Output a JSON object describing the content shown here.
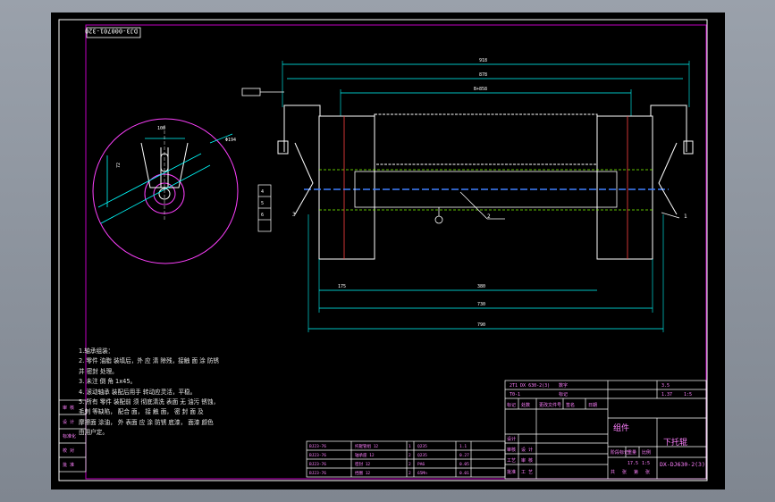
{
  "drawing": {
    "code_tag": "DJ3-000701-320",
    "title_component": "组件",
    "title_name": "下托辊",
    "title_code": "DX-DJ630-2(3)"
  },
  "notes": [
    "1.轴承组装：",
    "2. 零件 油脂 装填后，外 应 清 除残，接触 面 涂 防锈",
    "  并 密封 处理。",
    "3. 未注 倒 角 1x45。",
    "4. 滚动轴承 装配后用手 转动应灵活，平稳。",
    "5. 所有 零件 装配前 须 彻底清洗 表面 无 油污 锈蚀，",
    "  毛刺 等缺陷， 配合 面， 接 触 面， 密 封 面 及",
    "  摩擦面 涂油， 外 表面 应 涂 防锈 底漆， 面漆 颜色",
    "  由用户定。"
  ],
  "dimensions": {
    "top1": "918",
    "top2": "878",
    "top3": "B+858",
    "bottom_left": "175",
    "bottom_mid": "380",
    "bottom_total1": "730",
    "bottom_total2": "790",
    "circle_diameter": "Φ194",
    "circle_width": "100",
    "circle_height": "72"
  },
  "callouts": [
    "1",
    "2",
    "3",
    "4",
    "5",
    "6"
  ],
  "left_stack_labels": [
    "审 核",
    "设 计",
    "标准化",
    "校 对",
    "批 准"
  ],
  "bom_rows": [
    {
      "a": "BJ23-76",
      "b": "托辊管组 12",
      "c": "1",
      "d": "Q235",
      "e": "1.1"
    },
    {
      "a": "BJ23-76",
      "b": "轴承座 12",
      "c": "2",
      "d": "Q235",
      "e": "0.27"
    },
    {
      "a": "BJ23-76",
      "b": "密封 12",
      "c": "2",
      "d": "PA6",
      "e": "0.05"
    },
    {
      "a": "BJ23-76",
      "b": "挡圈 12",
      "c": "2",
      "d": "65Mn",
      "e": "0.01"
    }
  ],
  "title_block": {
    "row1": [
      "2T1 DX 630-2(3)",
      "数字"
    ],
    "row2": [
      "T0-1",
      "标记"
    ],
    "header": [
      "标记",
      "处数",
      "更改文件号",
      "签名",
      "日期"
    ],
    "roles": [
      "设计",
      "审核",
      "工艺",
      "批准"
    ],
    "scale_labels": [
      "阶段标记",
      "重量",
      "比例"
    ],
    "scale_values": [
      "",
      "17.5",
      "1:5"
    ],
    "sheet_info": [
      "共",
      "张",
      "第",
      "张"
    ],
    "right_cols": [
      "3.5",
      "1.37",
      "1:5"
    ],
    "bottom_labels": [
      "设 计",
      "审 核",
      "工 艺"
    ]
  }
}
